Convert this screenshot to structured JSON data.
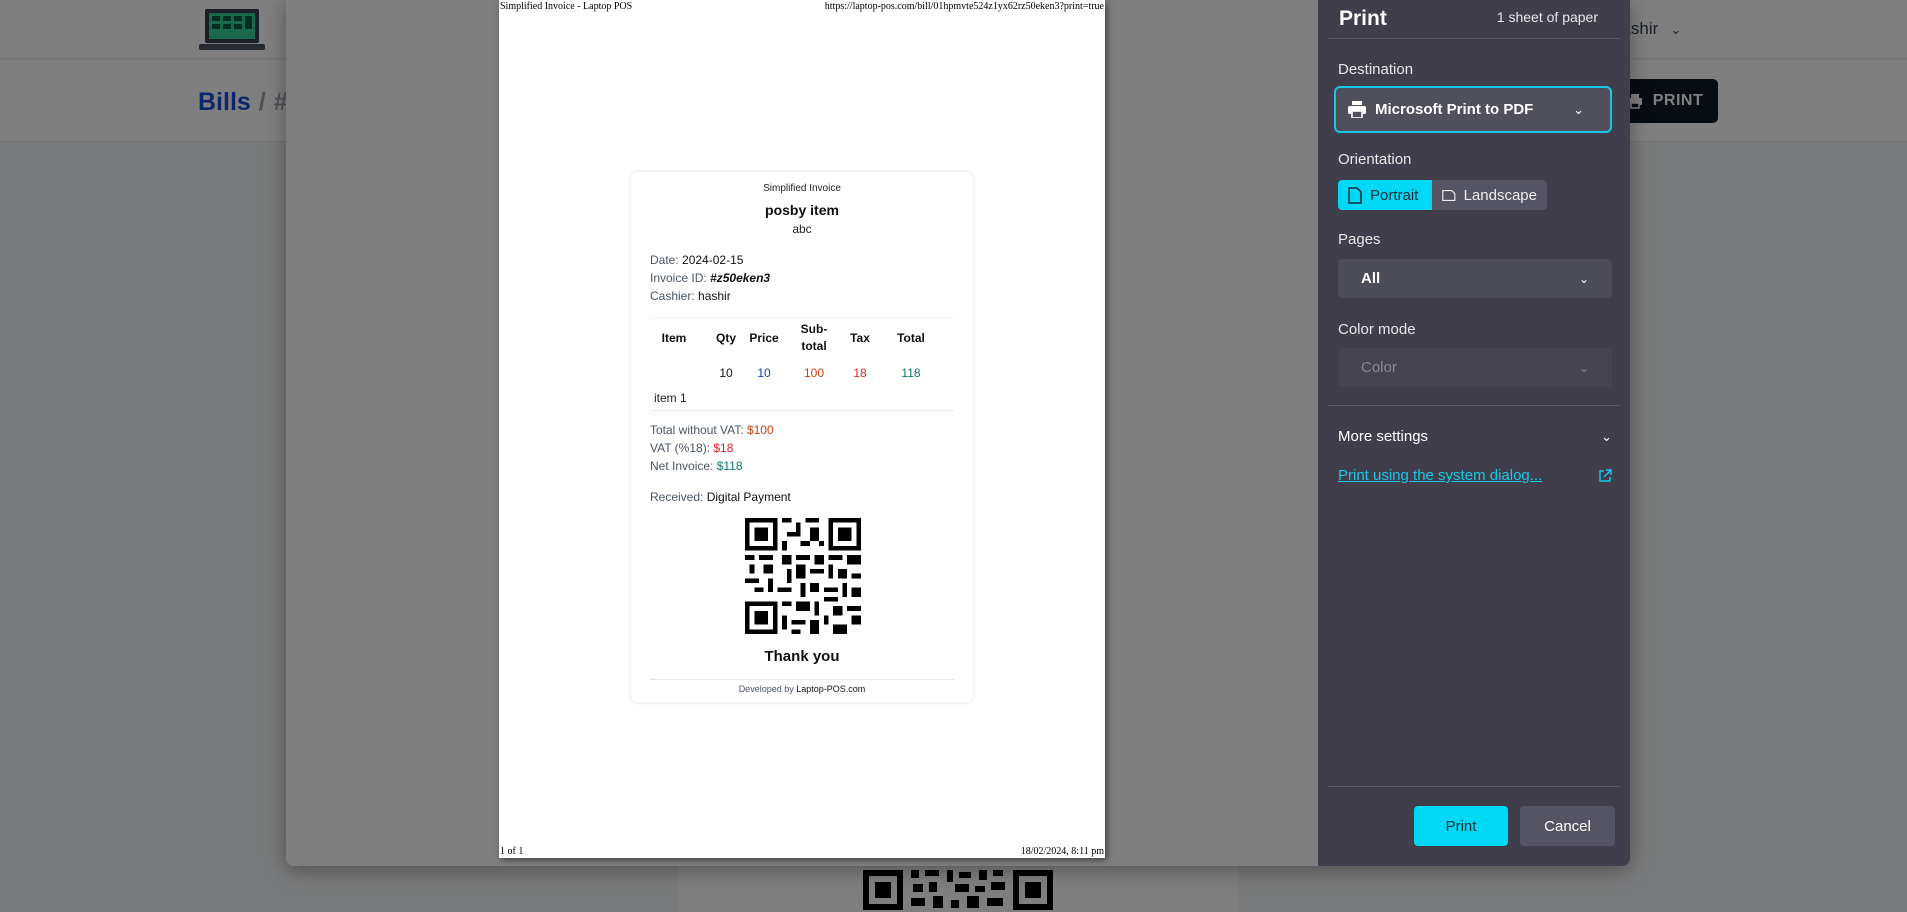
{
  "background": {
    "user_name": "hashir",
    "breadcrumb": {
      "link": "Bills",
      "separator": "/",
      "current": "#z"
    },
    "print_button_label": "PRINT"
  },
  "preview": {
    "header_title": "Simplified Invoice - Laptop POS",
    "header_url": "https://laptop-pos.com/bill/01hpmvte524z1yx62rz50eken3?print=true",
    "footer_pages": "1 of 1",
    "footer_datetime": "18/02/2024, 8:11 pm",
    "invoice": {
      "kind": "Simplified Invoice",
      "store": "posby item",
      "branch": "abc",
      "date_label": "Date:",
      "date": "2024-02-15",
      "invoice_id_label": "Invoice ID:",
      "invoice_id": "#z50eken3",
      "cashier_label": "Cashier:",
      "cashier": "hashir",
      "table": {
        "headers": [
          "Item",
          "Qty",
          "Price",
          "Sub-total",
          "Tax",
          "Total"
        ],
        "rows": [
          {
            "qty": "10",
            "price": "10",
            "subtotal": "100",
            "tax": "18",
            "total": "118",
            "item": "item 1"
          }
        ]
      },
      "total_without_vat_label": "Total without VAT:",
      "total_without_vat": "$100",
      "vat_label": "VAT (%18):",
      "vat": "$18",
      "net_label": "Net Invoice:",
      "net": "$118",
      "received_label": "Received:",
      "received": "Digital Payment",
      "thanks": "Thank you",
      "developed_by_label": "Developed by",
      "developed_by": "Laptop-POS.com"
    }
  },
  "panel": {
    "title": "Print",
    "sheets": "1 sheet of paper",
    "destination_label": "Destination",
    "destination": "Microsoft Print to PDF",
    "orientation_label": "Orientation",
    "portrait": "Portrait",
    "landscape": "Landscape",
    "pages_label": "Pages",
    "pages": "All",
    "color_mode_label": "Color mode",
    "color_mode": "Color",
    "more_settings": "More settings",
    "system_dialog": "Print using the system dialog...",
    "print_button": "Print",
    "cancel_button": "Cancel",
    "accent_color": "#00d9f5"
  }
}
